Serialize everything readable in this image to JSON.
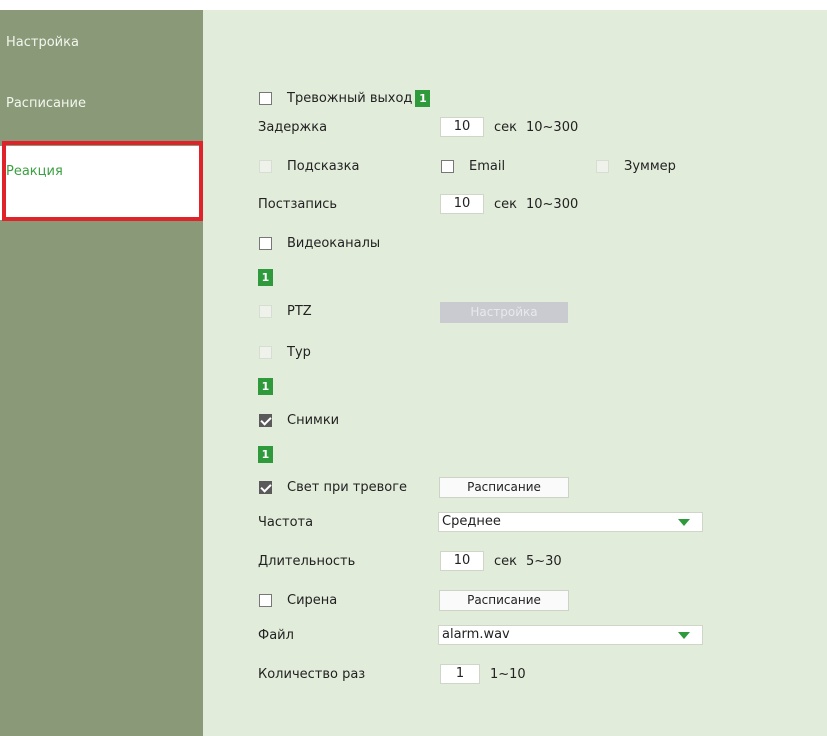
{
  "sidebar": {
    "items": [
      {
        "label": "Настройка"
      },
      {
        "label": "Расписание"
      },
      {
        "label": "Реакция"
      }
    ]
  },
  "form": {
    "alarm_out": {
      "label": "Тревожный выход",
      "badge": "1"
    },
    "delay": {
      "label": "Задержка",
      "value": "10",
      "unit": "сек",
      "range": "10~300"
    },
    "hint": {
      "label": "Подсказка"
    },
    "email": {
      "label": "Email"
    },
    "buzzer": {
      "label": "Зуммер"
    },
    "post_record": {
      "label": "Постзапись",
      "value": "10",
      "unit": "сек",
      "range": "10~300"
    },
    "video_channels": {
      "label": "Видеоканалы",
      "badge": "1"
    },
    "ptz": {
      "label": "PTZ",
      "settings_button": "Настройка"
    },
    "tour": {
      "label": "Тур",
      "badge": "1"
    },
    "snapshots": {
      "label": "Снимки",
      "badge": "1"
    },
    "alarm_light": {
      "label": "Свет при тревоге",
      "schedule_button": "Расписание"
    },
    "frequency": {
      "label": "Частота",
      "value": "Среднее"
    },
    "duration": {
      "label": "Длительность",
      "value": "10",
      "unit": "сек",
      "range": "5~30"
    },
    "siren": {
      "label": "Сирена",
      "schedule_button": "Расписание"
    },
    "file": {
      "label": "Файл",
      "value": "alarm.wav"
    },
    "count": {
      "label": "Количество раз",
      "value": "1",
      "range": "1~10"
    }
  },
  "colors": {
    "sidebar_bg": "#8a9a78",
    "panel_bg": "#e2ecdb",
    "accent_green": "#2e9a3c",
    "highlight_red": "#e0222b"
  }
}
